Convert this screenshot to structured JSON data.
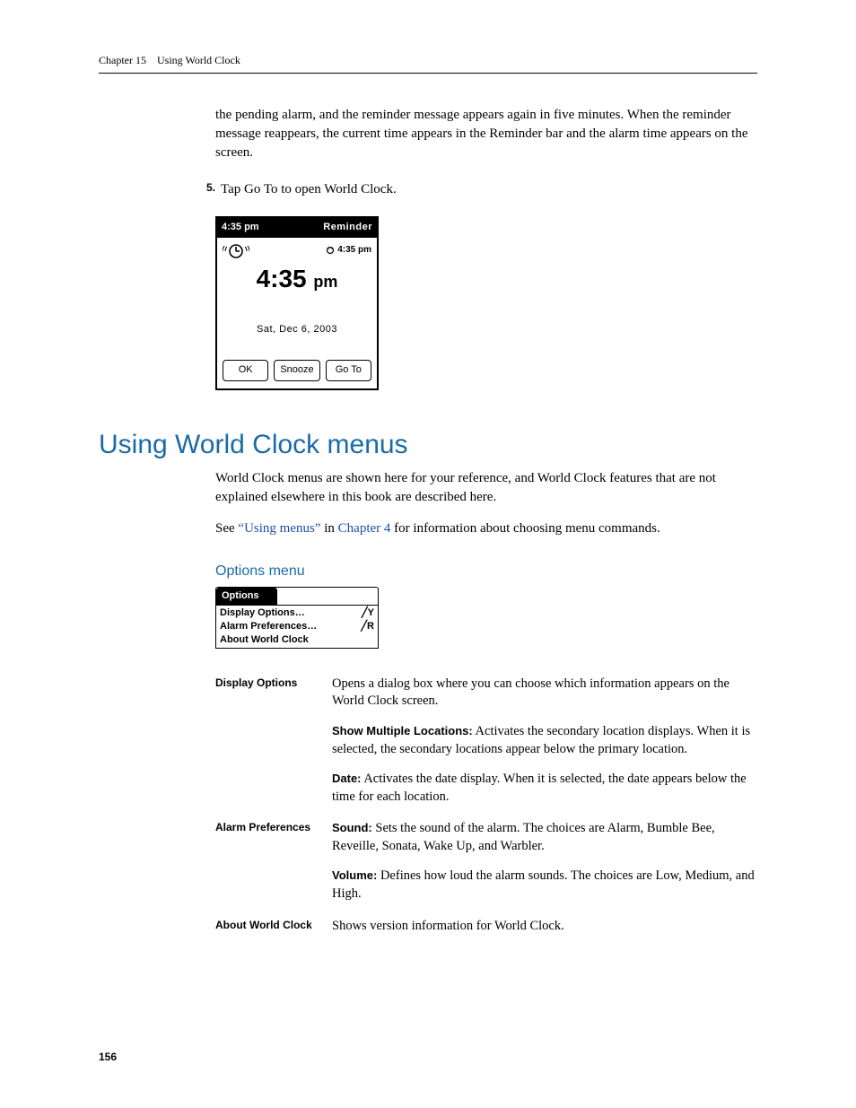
{
  "header": {
    "chapter": "Chapter 15",
    "title": "Using World Clock"
  },
  "intro": {
    "para1": "the pending alarm, and the reminder message appears again in five minutes. When the reminder message reappears, the current time appears in the Reminder bar and the alarm time appears on the screen.",
    "step_number": "5.",
    "step_text": "Tap Go To to open World Clock."
  },
  "reminder_device": {
    "status_left": "4:35 pm",
    "status_right": "Reminder",
    "alarm_small": "4:35 pm",
    "big_time": "4:35",
    "big_ampm": "pm",
    "date": "Sat, Dec 6, 2003",
    "btn_ok": "OK",
    "btn_snooze": "Snooze",
    "btn_goto": "Go To"
  },
  "section": {
    "h1": "Using World Clock menus",
    "para1": "World Clock menus are shown here for your reference, and World Clock features that are not explained elsewhere in this book are described here.",
    "see_prefix": "See ",
    "see_link1": "“Using menus”",
    "see_mid": " in ",
    "see_link2": "Chapter 4",
    "see_suffix": " for information about choosing menu commands."
  },
  "options_menu_heading": "Options menu",
  "options_menu_shot": {
    "tab": "Options",
    "items": [
      {
        "label": "Display Options…",
        "shortcut": "╱Y"
      },
      {
        "label": "Alarm Preferences…",
        "shortcut": "╱R"
      },
      {
        "label": "About World Clock",
        "shortcut": ""
      }
    ]
  },
  "definitions": {
    "display_options": {
      "label": "Display Options",
      "p1": "Opens a dialog box where you can choose which information appears on the World Clock screen.",
      "p2_bold": "Show Multiple Locations:",
      "p2": " Activates the secondary location displays. When it is selected, the secondary locations appear below the primary location.",
      "p3_bold": "Date:",
      "p3": " Activates the date display. When it is selected, the date appears below the time for each location."
    },
    "alarm_prefs": {
      "label": "Alarm Preferences",
      "p1_bold": "Sound:",
      "p1": " Sets the sound of the alarm. The choices are Alarm, Bumble Bee, Reveille, Sonata, Wake Up, and Warbler.",
      "p2_bold": "Volume:",
      "p2": " Defines how loud the alarm sounds. The choices are Low, Medium, and High."
    },
    "about": {
      "label": "About World Clock",
      "p1": "Shows version information for World Clock."
    }
  },
  "page_number": "156"
}
